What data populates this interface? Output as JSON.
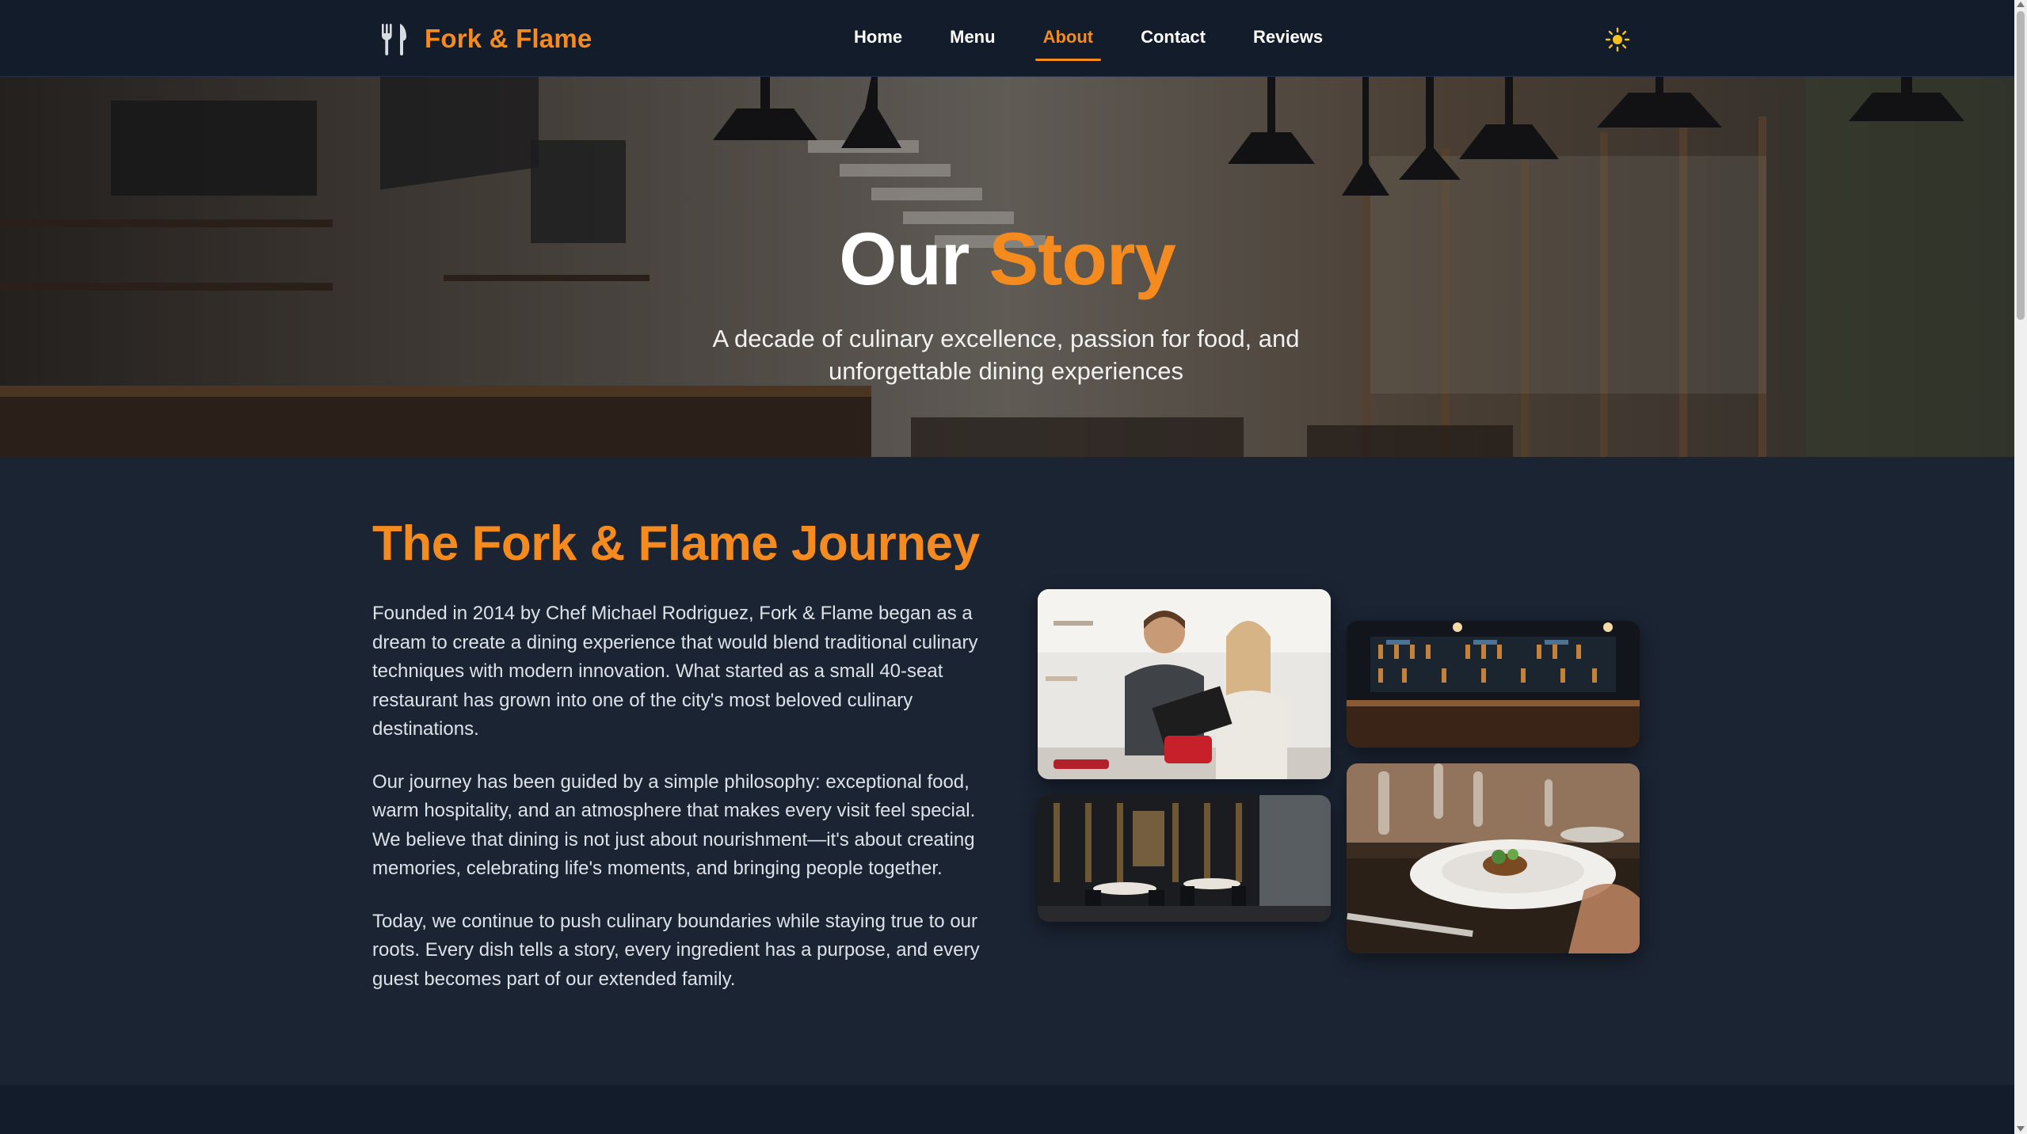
{
  "brand": {
    "name": "Fork & Flame",
    "icon": "fork-knife-icon"
  },
  "nav": {
    "items": [
      {
        "label": "Home",
        "active": false
      },
      {
        "label": "Menu",
        "active": false
      },
      {
        "label": "About",
        "active": true
      },
      {
        "label": "Contact",
        "active": false
      },
      {
        "label": "Reviews",
        "active": false
      }
    ],
    "theme_toggle_icon": "sun-icon"
  },
  "hero": {
    "title_part1": "Our",
    "title_part2": "Story",
    "subtitle": "A decade of culinary excellence, passion for food, and unforgettable dining experiences"
  },
  "journey": {
    "title": "The Fork & Flame Journey",
    "paragraphs": [
      "Founded in 2014 by Chef Michael Rodriguez, Fork & Flame began as a dream to create a dining experience that would blend traditional culinary techniques with modern innovation. What started as a small 40-seat restaurant has grown into one of the city's most beloved culinary destinations.",
      "Our journey has been guided by a simple philosophy: exceptional food, warm hospitality, and an atmosphere that makes every visit feel special. We believe that dining is not just about nourishment—it's about creating memories, celebrating life's moments, and bringing people together.",
      "Today, we continue to push culinary boundaries while staying true to our roots. Every dish tells a story, every ingredient has a purpose, and every guest becomes part of our extended family."
    ]
  },
  "colors": {
    "accent": "#f58a1f",
    "nav_bg": "#131c2b",
    "page_bg": "#1b2433"
  }
}
